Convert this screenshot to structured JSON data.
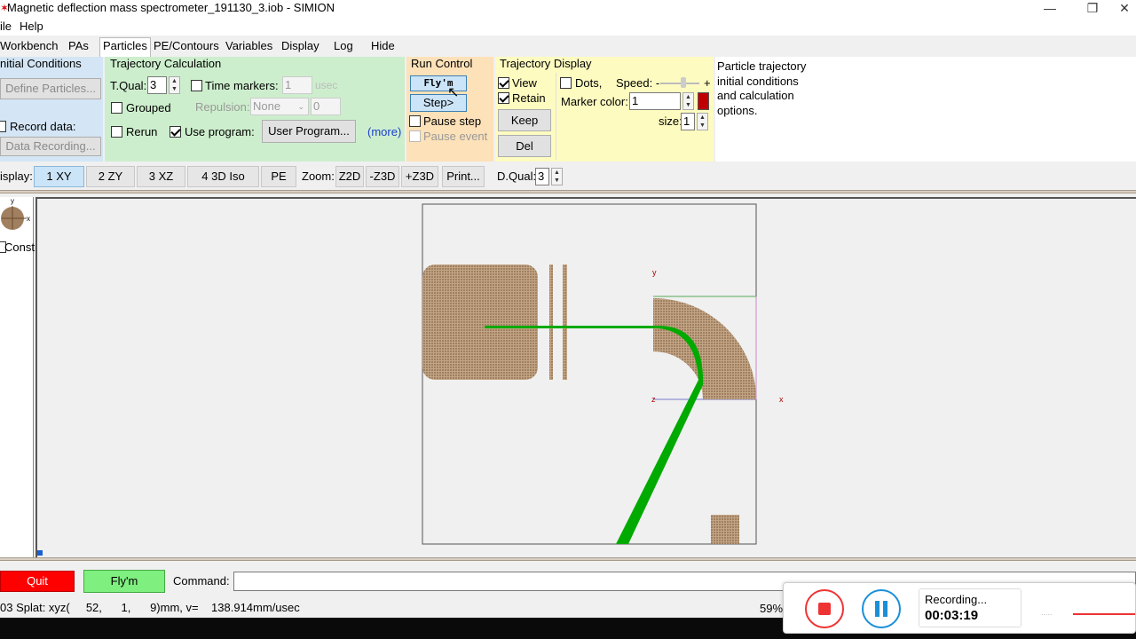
{
  "window": {
    "title": "Magnetic deflection mass spectrometer_191130_3.iob - SIMION",
    "minimize": "—",
    "restore": "❐",
    "close": "✕"
  },
  "menu": {
    "file": "ile",
    "help": "Help"
  },
  "tabs": [
    "Workbench",
    "PAs",
    "Particles",
    "PE/Contours",
    "Variables",
    "Display",
    "Log",
    "Hide"
  ],
  "initial_conditions": {
    "title": "nitial Conditions",
    "define_particles": "Define Particles...",
    "record_data": "Record data:",
    "data_recording": "Data Recording..."
  },
  "trajectory_calc": {
    "title": "Trajectory Calculation",
    "tqual_label": "T.Qual:",
    "tqual_value": "3",
    "time_markers": "Time markers:",
    "time_markers_value": "1",
    "time_markers_unit": "usec",
    "grouped": "Grouped",
    "repulsion": "Repulsion:",
    "repulsion_value": "None",
    "repulsion_num": "0",
    "rerun": "Rerun",
    "use_program": "Use program:",
    "user_program": "User Program...",
    "more": "(more)"
  },
  "run_control": {
    "title": "Run Control",
    "flym": "Fly'm",
    "step": "Step>",
    "pause_step": "Pause step",
    "pause_event": "Pause event"
  },
  "trajectory_display": {
    "title": "Trajectory Display",
    "view": "View",
    "retain": "Retain",
    "keep": "Keep",
    "del": "Del",
    "dots": "Dots,",
    "speed": "Speed: -",
    "speed_plus": "+",
    "marker_color": "Marker color:",
    "marker_color_value": "1",
    "marker_color_hex": "#c00000",
    "size": "size:",
    "size_value": "1"
  },
  "help_text": "Particle trajectory initial conditions and calculation options.",
  "toolbar": {
    "display_label": "isplay:",
    "views": [
      "1 XY",
      "2 ZY",
      "3 XZ",
      "4 3D Iso",
      "PE"
    ],
    "zoom_label": "Zoom:",
    "zoom_buttons": [
      "Z2D",
      "-Z3D",
      "+Z3D"
    ],
    "print": "Print...",
    "dqual_label": "D.Qual:",
    "dqual_value": "3"
  },
  "left_pane": {
    "constrn": "Constrn",
    "axis_y": "y",
    "axis_x": "x"
  },
  "canvas": {
    "axis_y": "y",
    "axis_x": "x",
    "axis_z": "z",
    "electrode_color": "#a08060",
    "trajectory_color": "#00aa00"
  },
  "bottom": {
    "quit": "Quit",
    "flym": "Fly'm",
    "command_label": "Command:",
    "command_value": ""
  },
  "status": {
    "splat": "03 Splat: xyz(     52,      1,      9)mm, v=    138.914mm/usec",
    "zoom": "59%"
  },
  "recorder": {
    "status": "Recording...",
    "time": "00:03:19"
  }
}
